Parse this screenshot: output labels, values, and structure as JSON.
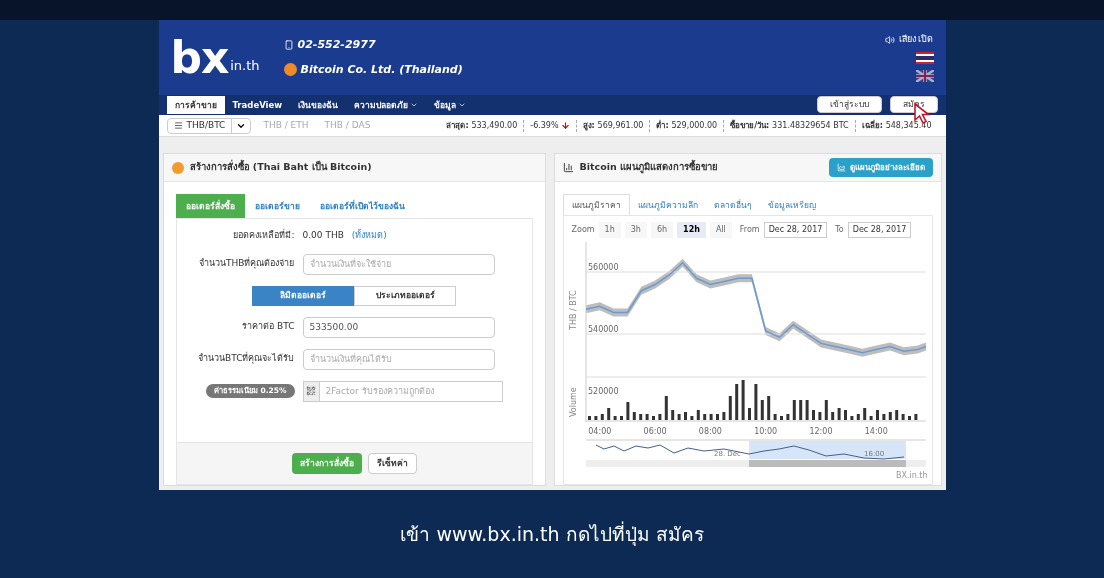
{
  "header": {
    "logo": "bx",
    "logo_suffix": "in.th",
    "phone": "02-552-2977",
    "company": "Bitcoin Co. Ltd. (Thailand)",
    "sound": "เสียง เปิด"
  },
  "nav": {
    "items": [
      {
        "label": "การค้าขาย",
        "selected": true,
        "dropdown": false
      },
      {
        "label": "TradeView",
        "selected": false,
        "dropdown": false
      },
      {
        "label": "เงินของฉัน",
        "selected": false,
        "dropdown": false
      },
      {
        "label": "ความปลอดภัย",
        "selected": false,
        "dropdown": true
      },
      {
        "label": "ข้อมูล",
        "selected": false,
        "dropdown": true
      }
    ],
    "login": "เข้าสู่ระบบ",
    "signup": "สมัคร"
  },
  "ticker": {
    "pair": "THB/BTC",
    "pairs": [
      "THB / ETH",
      "THB / DAS"
    ],
    "stats": [
      {
        "label": "ล่าสุด:",
        "value": "533,490.00"
      },
      {
        "value": "-6.39%",
        "kind": "change"
      },
      {
        "label": "สูง:",
        "value": "569,961.00"
      },
      {
        "label": "ต่ำ:",
        "value": "529,000.00"
      },
      {
        "label": "ซื้อขาย/วัน:",
        "value": "331.48329654 BTC"
      },
      {
        "label": "เฉลี่ย:",
        "value": "548,345.40"
      }
    ]
  },
  "order": {
    "title": "สร้างการสั่งซื้อ (Thai Baht เป็น Bitcoin)",
    "tabs": [
      {
        "label": "ออเดอร์สั่งซื้อ",
        "selected": true
      },
      {
        "label": "ออเดอร์ขาย",
        "selected": false
      },
      {
        "label": "ออเดอร์ที่เปิดไว้ของฉัน",
        "selected": false
      }
    ],
    "balance_label": "ยอดคงเหลือที่มี:",
    "balance": "0.00 THB",
    "balance_link": "(ทั้งหมด)",
    "pay_label": "จำนวนTHBที่คุณต้องจ่าย",
    "pay_placeholder": "จำนวนเงินที่จะใช้จ่าย",
    "types": [
      {
        "label": "ลิมิตออเดอร์",
        "selected": true
      },
      {
        "label": "ประเภทออเดอร์",
        "selected": false
      }
    ],
    "price_label": "ราคาต่อ BTC",
    "price": "533500.00",
    "receive_label": "จำนวนBTCที่คุณจะได้รับ",
    "receive_placeholder": "จำนวนเงินที่คุณได้รับ",
    "fee": "ค่าธรรมเนียม 0.25%",
    "twofactor_placeholder": "2Factor รับรองความถูกต้อง",
    "submit": "สร้างการสั่งซื้อ",
    "reset": "รีเซ็ทค่า"
  },
  "chart_panel": {
    "title": "Bitcoin แผนภูมิแสดงการซื้อขาย",
    "detail_button": "ดูแผนภูมิอย่างละเอียด",
    "tabs": [
      {
        "label": "แผนภูมิราคา",
        "selected": true
      },
      {
        "label": "แผนภูมิความลึก",
        "selected": false
      },
      {
        "label": "ตลาดอื่นๆ",
        "selected": false
      },
      {
        "label": "ข้อมูลเหรียญ",
        "selected": false
      }
    ],
    "zoom_label": "Zoom",
    "zooms": [
      {
        "label": "1h",
        "selected": false
      },
      {
        "label": "3h",
        "selected": false
      },
      {
        "label": "6h",
        "selected": false
      },
      {
        "label": "12h",
        "selected": true
      },
      {
        "label": "All",
        "selected": false
      }
    ],
    "from_label": "From",
    "from": "Dec 28, 2017",
    "to_label": "To",
    "to": "Dec 28, 2017",
    "chart_data": {
      "type": "line",
      "ylabel": "THB / BTC",
      "xlim": [
        3.5,
        15.8
      ],
      "ylim": [
        512000,
        569700
      ],
      "yticks": [
        520000,
        540000,
        560000
      ],
      "xticks": [
        {
          "value": 4,
          "label": "04:00"
        },
        {
          "value": 6,
          "label": "06:00"
        },
        {
          "value": 8,
          "label": "08:00"
        },
        {
          "value": 10,
          "label": "10:00"
        },
        {
          "value": 12,
          "label": "12:00"
        },
        {
          "value": 14,
          "label": "14:00"
        }
      ],
      "x": [
        3.5,
        4,
        4.5,
        5,
        5.5,
        6,
        6.5,
        7,
        7.5,
        8,
        8.5,
        9,
        9.5,
        10,
        10.5,
        11,
        11.5,
        12,
        12.5,
        13,
        13.5,
        14,
        14.5,
        15,
        15.5,
        15.8
      ],
      "series": [
        {
          "color": "#6b9bd1",
          "values": [
            548000,
            549000,
            547000,
            547000,
            554000,
            556000,
            559000,
            563000,
            558000,
            556000,
            557000,
            558000,
            558000,
            541000,
            539000,
            543000,
            540000,
            537000,
            536000,
            535000,
            534000,
            535000,
            536000,
            534500,
            535000,
            536000
          ]
        }
      ]
    },
    "volume_label": "Volume",
    "navigator_label": "28. Dec",
    "navigator_tick": "16:00",
    "credit": "BX.in.th"
  },
  "caption": "เข้า www.bx.in.th กดไปที่ปุ่ม สมัคร"
}
